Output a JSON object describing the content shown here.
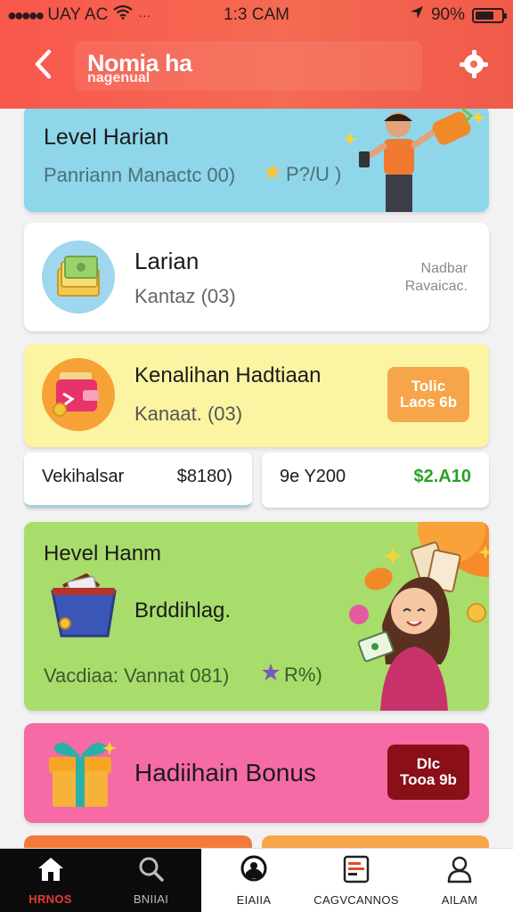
{
  "status_bar": {
    "carrier": "UAY AC",
    "time": "1:3 CAM",
    "battery": "90%"
  },
  "header": {
    "title": "Nomia ha",
    "subtitle": "nagenual",
    "back_icon": "chevron-left-icon",
    "action_icon": "settings-icon"
  },
  "cards": {
    "level_harian": {
      "title": "Level Harian",
      "subtitle": "Panriann Manactc 00)",
      "reward": "P?/U )"
    },
    "larian": {
      "title": "Larian",
      "subtitle": "Kantaz (03)",
      "side_line1": "Nadbar",
      "side_line2": "Ravaicac."
    },
    "kenalihan": {
      "title": "Kenalihan Hadtiaan",
      "subtitle": "Kanaat. (03)",
      "button_line1": "Tolic",
      "button_line2": "Laos 6b"
    },
    "stats": {
      "left_label": "Vekihalsar",
      "left_value": "$8180)",
      "right_label": "9e Y200",
      "right_value": "$2.A10"
    },
    "hevel_hanm": {
      "title": "Hevel Hanm",
      "subtitle": "Brddihlag.",
      "footer": "Vacdiaa: Vannat 081)",
      "reward": "R%)"
    },
    "hadiah_bonus": {
      "title": "Hadiihain Bonus",
      "button_line1": "Dlc",
      "button_line2": "Tooa 9b"
    }
  },
  "nav": {
    "items": [
      {
        "label": "HRNOS",
        "icon": "home-icon",
        "active": true
      },
      {
        "label": "BNIIAI",
        "icon": "search-icon",
        "active": false
      },
      {
        "label": "EIAIIA",
        "icon": "gamepad-icon",
        "active": false
      },
      {
        "label": "CAGVCANNOS",
        "icon": "list-icon",
        "active": false
      },
      {
        "label": "AILAM",
        "icon": "user-icon",
        "active": false
      }
    ]
  },
  "colors": {
    "header": "#f9574d",
    "card_blue": "#8fd6ea",
    "card_yellow": "#fbf4a2",
    "card_green": "#a8dd6c",
    "card_pink": "#f66aa6",
    "button_orange": "#f6a54a",
    "button_dark_red": "#8a0f18",
    "nav_active": "#e53b35",
    "stat_green": "#2aa02a"
  }
}
